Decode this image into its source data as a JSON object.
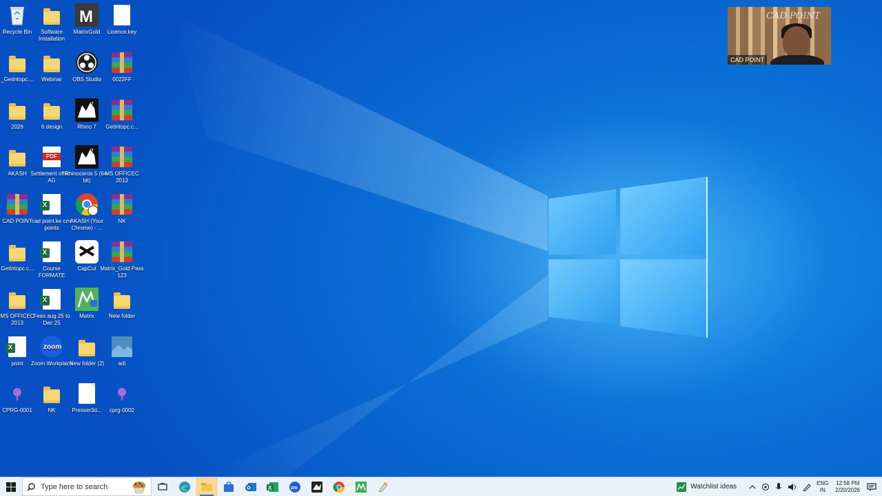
{
  "desktop": {
    "icons": [
      {
        "label": "Recycle Bin",
        "icon": "recycle-bin-icon"
      },
      {
        "label": "Software Installation",
        "icon": "folder-icon"
      },
      {
        "label": "MatrixGold",
        "icon": "matrixgold-icon"
      },
      {
        "label": "Licence.key",
        "icon": "file-icon"
      },
      {
        "label": "_Getintopc....",
        "icon": "folder-icon"
      },
      {
        "label": "Webinar",
        "icon": "folder-icon"
      },
      {
        "label": "OBS Studio",
        "icon": "obs-icon"
      },
      {
        "label": "0022FF",
        "icon": "winrar-icon"
      },
      {
        "label": "2026",
        "icon": "folder-icon"
      },
      {
        "label": "6 design",
        "icon": "folder-icon"
      },
      {
        "label": "Rhino 7",
        "icon": "rhino-icon"
      },
      {
        "label": "Getintopc.c...",
        "icon": "winrar-icon"
      },
      {
        "label": "AKASH",
        "icon": "folder-icon"
      },
      {
        "label": "Settlement offer - AG",
        "icon": "pdf-icon"
      },
      {
        "label": "Rhinoceros 5 (64-bit)",
        "icon": "rhino-icon"
      },
      {
        "label": "MS OFFICEC 2013",
        "icon": "winrar-icon"
      },
      {
        "label": "CAD POINT",
        "icon": "winrar-icon"
      },
      {
        "label": "cad point.ke cmi points",
        "icon": "excel-icon"
      },
      {
        "label": "AKASH (Your Chrome) - ...",
        "icon": "chrome-icon"
      },
      {
        "label": "NK",
        "icon": "winrar-icon"
      },
      {
        "label": "Getintopc.c...",
        "icon": "folder-icon"
      },
      {
        "label": "Course FORMATE",
        "icon": "excel-icon"
      },
      {
        "label": "CapCut",
        "icon": "capcut-icon"
      },
      {
        "label": "Matrix_Gold Pass 123",
        "icon": "winrar-icon"
      },
      {
        "label": "MS OFFICEC 2013",
        "icon": "folder-icon"
      },
      {
        "label": "Fees aug 25 to Dec 25",
        "icon": "excel-icon"
      },
      {
        "label": "Matrix",
        "icon": "matrix-icon"
      },
      {
        "label": "New folder",
        "icon": "folder-icon"
      },
      {
        "label": "point",
        "icon": "excel-icon"
      },
      {
        "label": "Zoom Workplace",
        "icon": "zoom-icon"
      },
      {
        "label": "New folder (2)",
        "icon": "folder-icon"
      },
      {
        "label": "adi",
        "icon": "image-icon"
      },
      {
        "label": "CPRG-0001",
        "icon": "cprg-icon"
      },
      {
        "label": "NK",
        "icon": "folder-icon"
      },
      {
        "label": "Presser3d...",
        "icon": "file-icon"
      },
      {
        "label": "cprg-0002",
        "icon": "cprg-icon"
      }
    ]
  },
  "webcam": {
    "name": "CAD POINT",
    "logo": "CAD POINT"
  },
  "taskbar": {
    "search_placeholder": "Type here to search",
    "apps": [
      "task-view-icon",
      "edge-icon",
      "file-explorer-icon",
      "store-icon",
      "outlook-icon",
      "excel-icon",
      "zoom-icon",
      "rhino-icon",
      "chrome-icon",
      "matrix-icon",
      "paint-icon"
    ],
    "widget_label": "Watchlist ideas",
    "language_top": "ENG",
    "language_bottom": "IN",
    "time": "12:58 PM",
    "date": "2/20/2026"
  },
  "colors": {
    "desktop_blue": "#0a6fd6",
    "taskbar": "#eaf1f9",
    "accent": "#2a72c8"
  }
}
